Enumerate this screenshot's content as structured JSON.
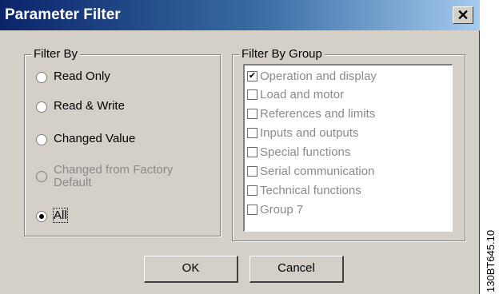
{
  "window": {
    "title": "Parameter Filter",
    "close_glyph": "✕"
  },
  "filter_by": {
    "legend": "Filter By",
    "options": [
      {
        "label": "Read Only",
        "checked": false,
        "disabled": false
      },
      {
        "label": "Read & Write",
        "checked": false,
        "disabled": false
      },
      {
        "label": "Changed Value",
        "checked": false,
        "disabled": false
      },
      {
        "label_line1": "Changed from Factory",
        "label_line2": "Default",
        "checked": false,
        "disabled": true
      },
      {
        "label": "All",
        "checked": true,
        "disabled": false
      }
    ]
  },
  "filter_by_group": {
    "legend": "Filter By Group",
    "items": [
      {
        "label": "Operation and display",
        "checked": true
      },
      {
        "label": "Load and motor",
        "checked": false
      },
      {
        "label": "References and limits",
        "checked": false
      },
      {
        "label": "Inputs and outputs",
        "checked": false
      },
      {
        "label": "Special functions",
        "checked": false
      },
      {
        "label": "Serial communication",
        "checked": false
      },
      {
        "label": "Technical functions",
        "checked": false
      },
      {
        "label": "Group 7",
        "checked": false
      }
    ],
    "check_glyph": "✔"
  },
  "buttons": {
    "ok": "OK",
    "cancel": "Cancel"
  },
  "figure_code": "130BT645.10",
  "colors": {
    "dialog_bg": "#d4d0c8",
    "title_start": "#0a246a",
    "title_end": "#a6caf0",
    "disabled_text": "#8a8a8a"
  }
}
